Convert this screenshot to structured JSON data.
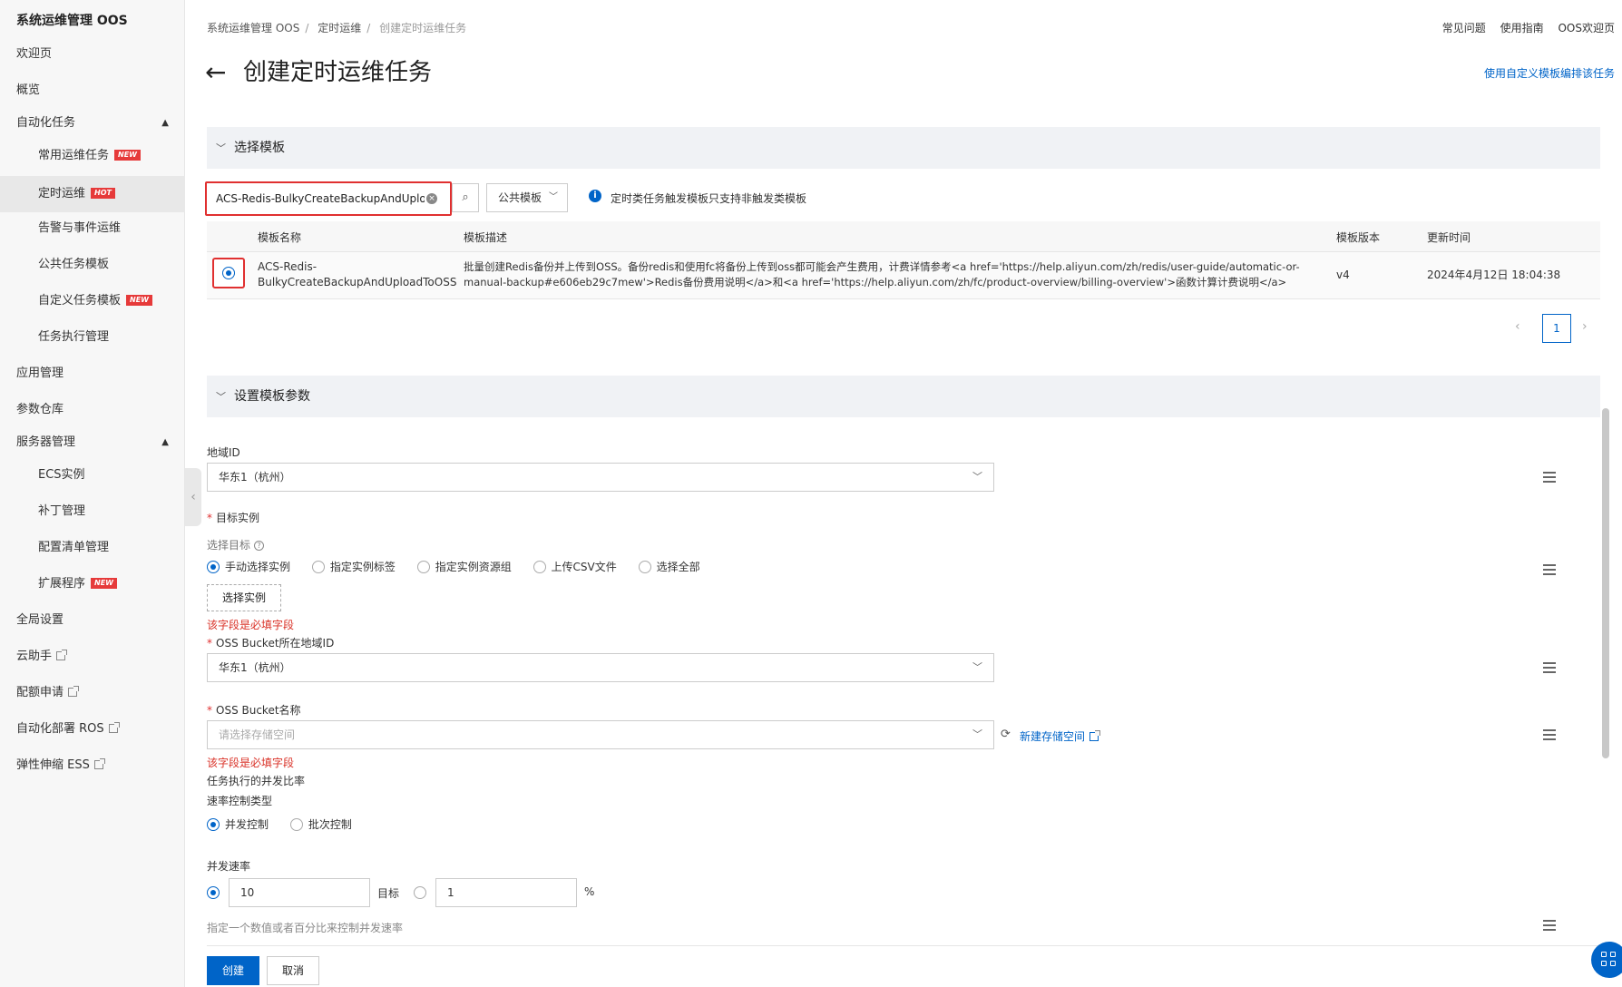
{
  "sidebar": {
    "title": "系统运维管理 OOS",
    "items": [
      {
        "label": "欢迎页"
      },
      {
        "label": "概览"
      },
      {
        "label": "自动化任务"
      },
      {
        "label": "常用运维任务",
        "tag": "NEW"
      },
      {
        "label": "定时运维",
        "tag": "HOT"
      },
      {
        "label": "告警与事件运维"
      },
      {
        "label": "公共任务模板"
      },
      {
        "label": "自定义任务模板",
        "tag": "NEW"
      },
      {
        "label": "任务执行管理"
      },
      {
        "label": "应用管理"
      },
      {
        "label": "参数仓库"
      },
      {
        "label": "服务器管理"
      },
      {
        "label": "ECS实例"
      },
      {
        "label": "补丁管理"
      },
      {
        "label": "配置清单管理"
      },
      {
        "label": "扩展程序",
        "tag": "NEW"
      },
      {
        "label": "全局设置"
      },
      {
        "label": "云助手"
      },
      {
        "label": "配额申请"
      },
      {
        "label": "自动化部署 ROS"
      },
      {
        "label": "弹性伸缩 ESS"
      }
    ]
  },
  "breadcrumb": [
    "系统运维管理 OOS",
    "定时运维",
    "创建定时运维任务"
  ],
  "breadcrumb_sep": "/",
  "toplinks": [
    "常见问题",
    "使用指南",
    "OOS欢迎页"
  ],
  "page": {
    "title": "创建定时运维任务",
    "edit_link": "使用自定义模板编排该任务"
  },
  "section1": {
    "title": "选择模板",
    "search_value": "ACS-Redis-BulkyCreateBackupAndUplo",
    "template_type": "公共模板",
    "info": "定时类任务触发模板只支持非触发类模板",
    "columns": [
      "模板名称",
      "模板描述",
      "模板版本",
      "更新时间"
    ],
    "row": {
      "name_line1": "ACS-Redis-",
      "name_line2": "BulkyCreateBackupAndUploadToOSS",
      "desc_line1": "批量创建Redis备份并上传到OSS。备份redis和使用fc将备份上传到oss都可能会产生费用，计费详情参考<a href='https://help.aliyun.com/zh/redis/user-guide/automatic-or-",
      "desc_line2": "manual-backup#e606eb29c7mew'>Redis备份费用说明</a>和<a href='https://help.aliyun.com/zh/fc/product-overview/billing-overview'>函数计算计费说明</a>",
      "version": "v4",
      "updated": "2024年4月12日 18:04:38"
    },
    "page": "1"
  },
  "section2": {
    "title": "设置模板参数",
    "region_label": "地域ID",
    "region_value": "华东1（杭州）",
    "target_label": "目标实例",
    "select_target_label": "选择目标",
    "target_options": [
      "手动选择实例",
      "指定实例标签",
      "指定实例资源组",
      "上传CSV文件",
      "选择全部"
    ],
    "select_instance_btn": "选择实例",
    "required_error": "该字段是必填字段",
    "bucket_region_label": "OSS Bucket所在地域ID",
    "bucket_region_value": "华东1（杭州）",
    "bucket_name_label": "OSS Bucket名称",
    "bucket_name_placeholder": "请选择存储空间",
    "new_bucket": "新建存储空间",
    "concurrency_label": "任务执行的并发比率",
    "rate_type_label": "速率控制类型",
    "rate_options": [
      "并发控制",
      "批次控制"
    ],
    "rate_label": "并发速率",
    "rate_value": "10",
    "rate_unit_target": "目标",
    "rate_percent_value": "1",
    "rate_percent_unit": "%",
    "rate_hint": "指定一个数值或者百分比来控制并发速率"
  },
  "footer": {
    "create": "创建",
    "cancel": "取消"
  },
  "colors": {
    "primary": "#0064c8",
    "error": "#d93026",
    "highlight": "#e03030"
  }
}
